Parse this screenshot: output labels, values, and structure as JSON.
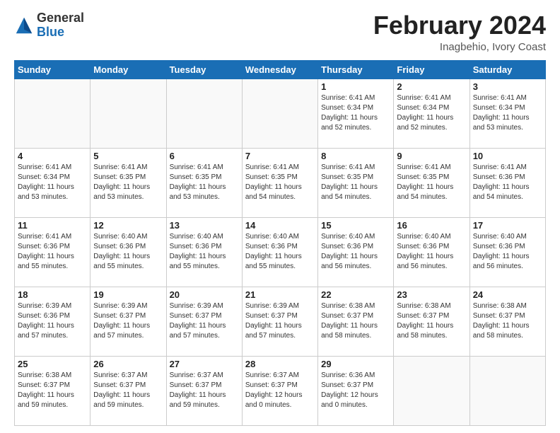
{
  "logo": {
    "general": "General",
    "blue": "Blue"
  },
  "header": {
    "title": "February 2024",
    "subtitle": "Inagbehio, Ivory Coast"
  },
  "weekdays": [
    "Sunday",
    "Monday",
    "Tuesday",
    "Wednesday",
    "Thursday",
    "Friday",
    "Saturday"
  ],
  "weeks": [
    [
      {
        "day": "",
        "info": ""
      },
      {
        "day": "",
        "info": ""
      },
      {
        "day": "",
        "info": ""
      },
      {
        "day": "",
        "info": ""
      },
      {
        "day": "1",
        "info": "Sunrise: 6:41 AM\nSunset: 6:34 PM\nDaylight: 11 hours\nand 52 minutes."
      },
      {
        "day": "2",
        "info": "Sunrise: 6:41 AM\nSunset: 6:34 PM\nDaylight: 11 hours\nand 52 minutes."
      },
      {
        "day": "3",
        "info": "Sunrise: 6:41 AM\nSunset: 6:34 PM\nDaylight: 11 hours\nand 53 minutes."
      }
    ],
    [
      {
        "day": "4",
        "info": "Sunrise: 6:41 AM\nSunset: 6:34 PM\nDaylight: 11 hours\nand 53 minutes."
      },
      {
        "day": "5",
        "info": "Sunrise: 6:41 AM\nSunset: 6:35 PM\nDaylight: 11 hours\nand 53 minutes."
      },
      {
        "day": "6",
        "info": "Sunrise: 6:41 AM\nSunset: 6:35 PM\nDaylight: 11 hours\nand 53 minutes."
      },
      {
        "day": "7",
        "info": "Sunrise: 6:41 AM\nSunset: 6:35 PM\nDaylight: 11 hours\nand 54 minutes."
      },
      {
        "day": "8",
        "info": "Sunrise: 6:41 AM\nSunset: 6:35 PM\nDaylight: 11 hours\nand 54 minutes."
      },
      {
        "day": "9",
        "info": "Sunrise: 6:41 AM\nSunset: 6:35 PM\nDaylight: 11 hours\nand 54 minutes."
      },
      {
        "day": "10",
        "info": "Sunrise: 6:41 AM\nSunset: 6:36 PM\nDaylight: 11 hours\nand 54 minutes."
      }
    ],
    [
      {
        "day": "11",
        "info": "Sunrise: 6:41 AM\nSunset: 6:36 PM\nDaylight: 11 hours\nand 55 minutes."
      },
      {
        "day": "12",
        "info": "Sunrise: 6:40 AM\nSunset: 6:36 PM\nDaylight: 11 hours\nand 55 minutes."
      },
      {
        "day": "13",
        "info": "Sunrise: 6:40 AM\nSunset: 6:36 PM\nDaylight: 11 hours\nand 55 minutes."
      },
      {
        "day": "14",
        "info": "Sunrise: 6:40 AM\nSunset: 6:36 PM\nDaylight: 11 hours\nand 55 minutes."
      },
      {
        "day": "15",
        "info": "Sunrise: 6:40 AM\nSunset: 6:36 PM\nDaylight: 11 hours\nand 56 minutes."
      },
      {
        "day": "16",
        "info": "Sunrise: 6:40 AM\nSunset: 6:36 PM\nDaylight: 11 hours\nand 56 minutes."
      },
      {
        "day": "17",
        "info": "Sunrise: 6:40 AM\nSunset: 6:36 PM\nDaylight: 11 hours\nand 56 minutes."
      }
    ],
    [
      {
        "day": "18",
        "info": "Sunrise: 6:39 AM\nSunset: 6:36 PM\nDaylight: 11 hours\nand 57 minutes."
      },
      {
        "day": "19",
        "info": "Sunrise: 6:39 AM\nSunset: 6:37 PM\nDaylight: 11 hours\nand 57 minutes."
      },
      {
        "day": "20",
        "info": "Sunrise: 6:39 AM\nSunset: 6:37 PM\nDaylight: 11 hours\nand 57 minutes."
      },
      {
        "day": "21",
        "info": "Sunrise: 6:39 AM\nSunset: 6:37 PM\nDaylight: 11 hours\nand 57 minutes."
      },
      {
        "day": "22",
        "info": "Sunrise: 6:38 AM\nSunset: 6:37 PM\nDaylight: 11 hours\nand 58 minutes."
      },
      {
        "day": "23",
        "info": "Sunrise: 6:38 AM\nSunset: 6:37 PM\nDaylight: 11 hours\nand 58 minutes."
      },
      {
        "day": "24",
        "info": "Sunrise: 6:38 AM\nSunset: 6:37 PM\nDaylight: 11 hours\nand 58 minutes."
      }
    ],
    [
      {
        "day": "25",
        "info": "Sunrise: 6:38 AM\nSunset: 6:37 PM\nDaylight: 11 hours\nand 59 minutes."
      },
      {
        "day": "26",
        "info": "Sunrise: 6:37 AM\nSunset: 6:37 PM\nDaylight: 11 hours\nand 59 minutes."
      },
      {
        "day": "27",
        "info": "Sunrise: 6:37 AM\nSunset: 6:37 PM\nDaylight: 11 hours\nand 59 minutes."
      },
      {
        "day": "28",
        "info": "Sunrise: 6:37 AM\nSunset: 6:37 PM\nDaylight: 12 hours\nand 0 minutes."
      },
      {
        "day": "29",
        "info": "Sunrise: 6:36 AM\nSunset: 6:37 PM\nDaylight: 12 hours\nand 0 minutes."
      },
      {
        "day": "",
        "info": ""
      },
      {
        "day": "",
        "info": ""
      }
    ]
  ]
}
